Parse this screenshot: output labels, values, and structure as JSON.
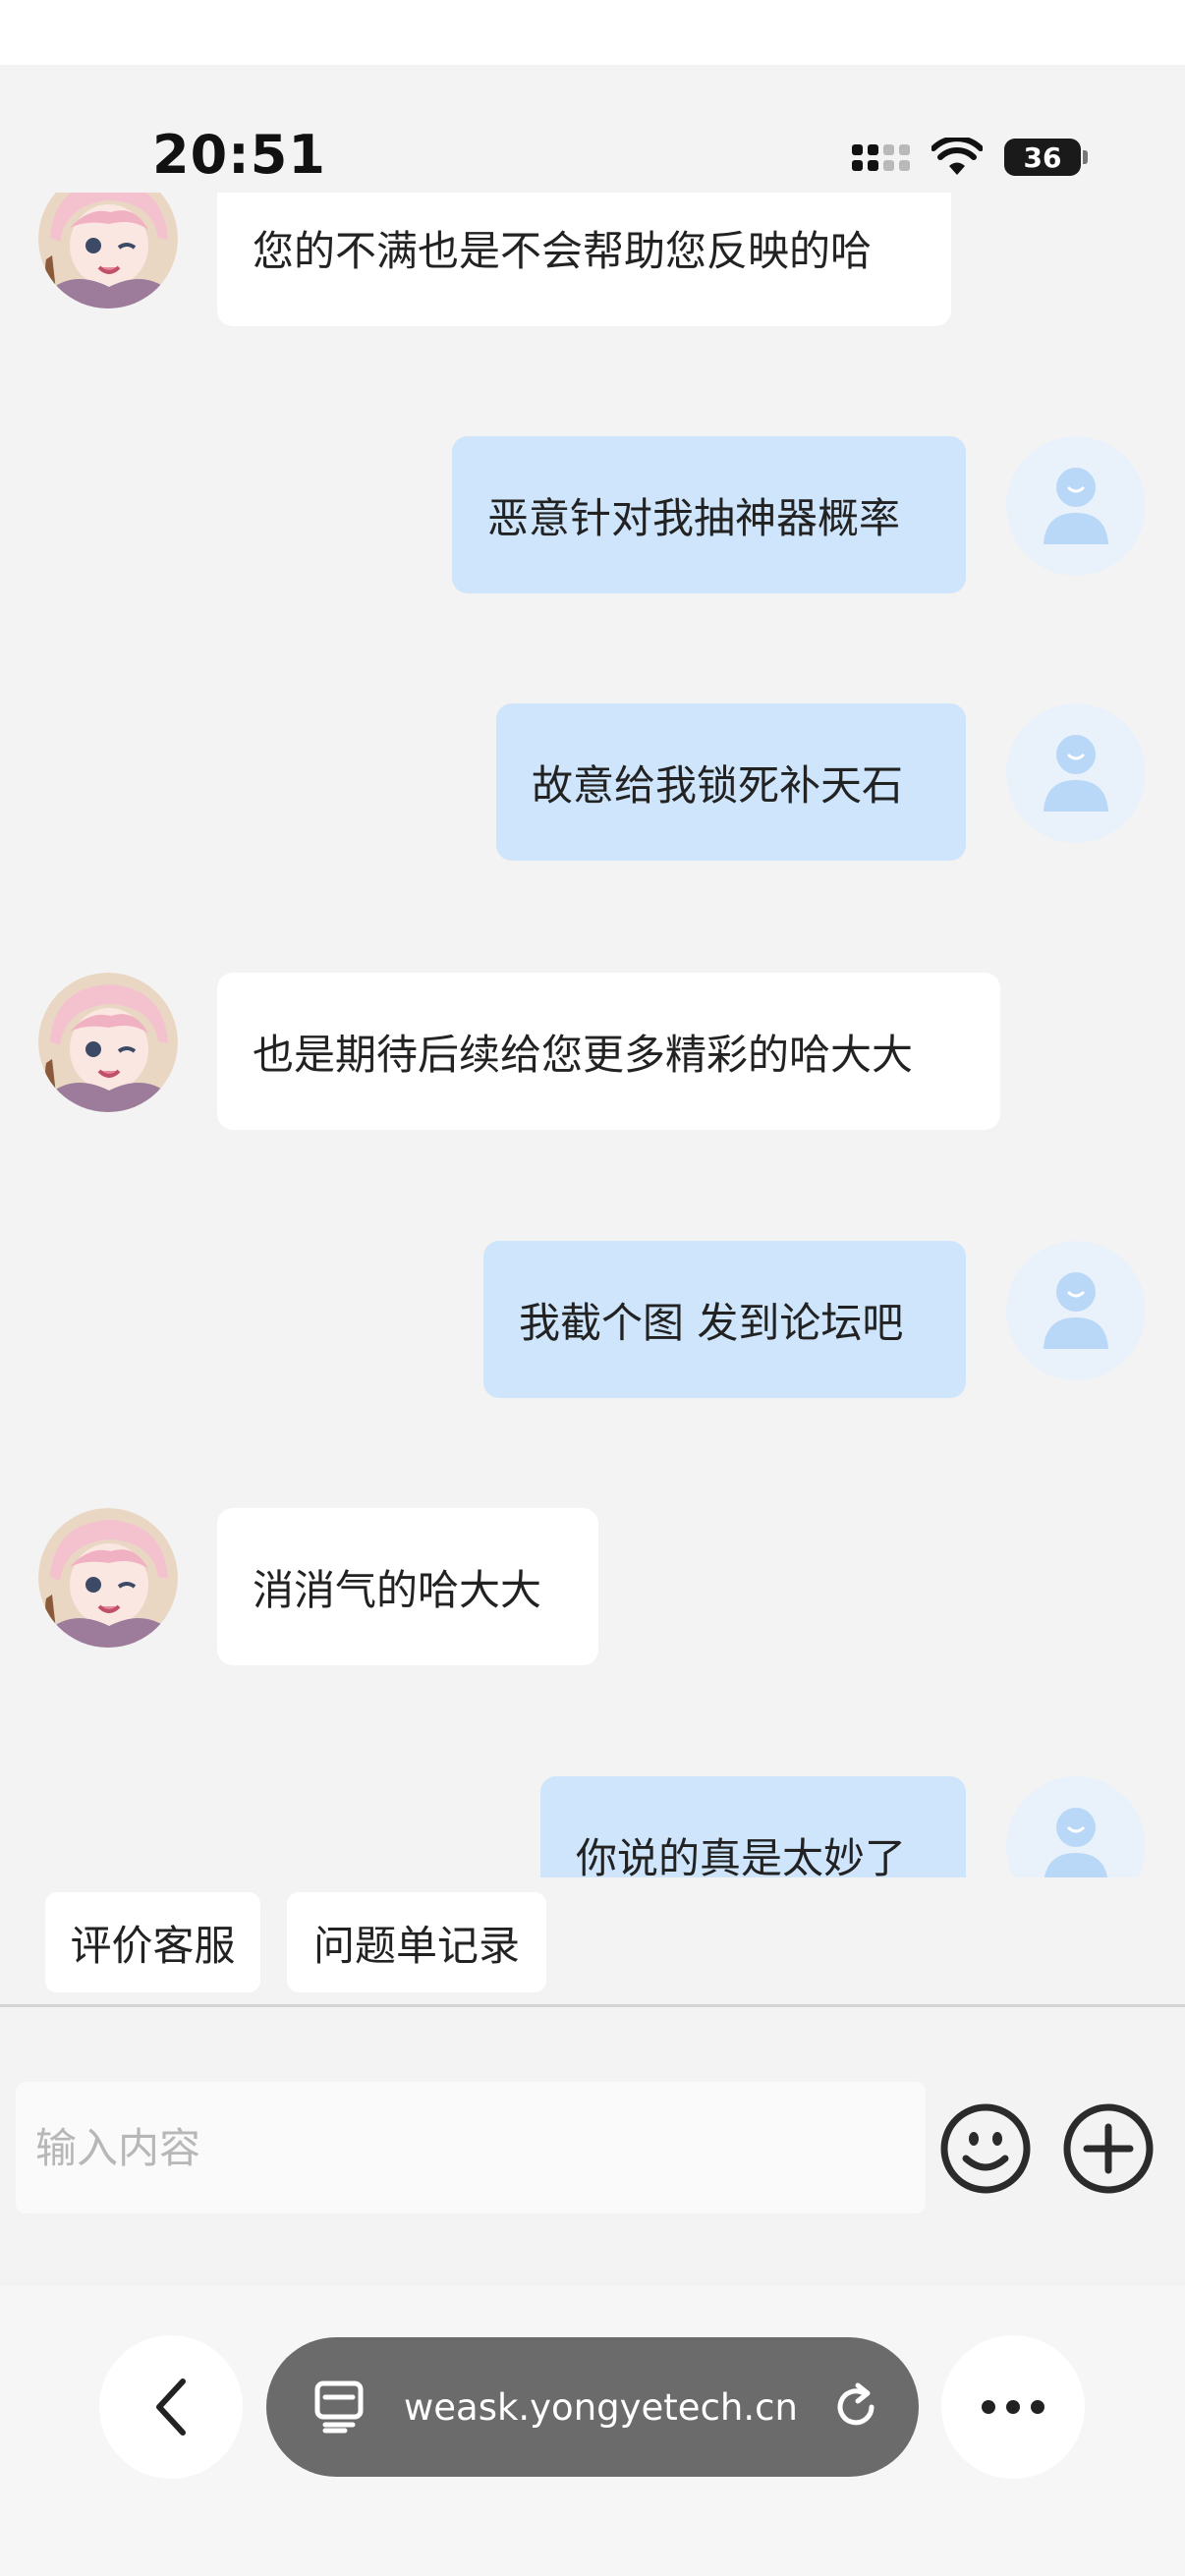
{
  "status": {
    "time": "20:51",
    "battery": "36"
  },
  "messages": [
    {
      "sender": "bot",
      "text": "您的不满也是不会帮助您反映的哈"
    },
    {
      "sender": "user",
      "text": "恶意针对我抽神器概率"
    },
    {
      "sender": "user",
      "text": "故意给我锁死补天石"
    },
    {
      "sender": "bot",
      "text": "也是期待后续给您更多精彩的哈大大"
    },
    {
      "sender": "user",
      "text": "我截个图 发到论坛吧"
    },
    {
      "sender": "bot",
      "text": "消消气的哈大大"
    },
    {
      "sender": "user",
      "text": "你说的真是太妙了"
    }
  ],
  "quick_actions": {
    "rate_agent": "评价客服",
    "ticket_records": "问题单记录"
  },
  "input": {
    "placeholder": "输入内容"
  },
  "browser": {
    "url": "weask.yongyetech.cn"
  },
  "colors": {
    "bot_bubble": "#ffffff",
    "user_bubble": "#cfe5fb",
    "background": "#f3f3f3",
    "url_pill": "#6b6b6b"
  },
  "icons": [
    "back-icon",
    "tabs-icon",
    "reload-icon",
    "more-icon",
    "emoji-icon",
    "plus-icon",
    "user-avatar-icon"
  ]
}
